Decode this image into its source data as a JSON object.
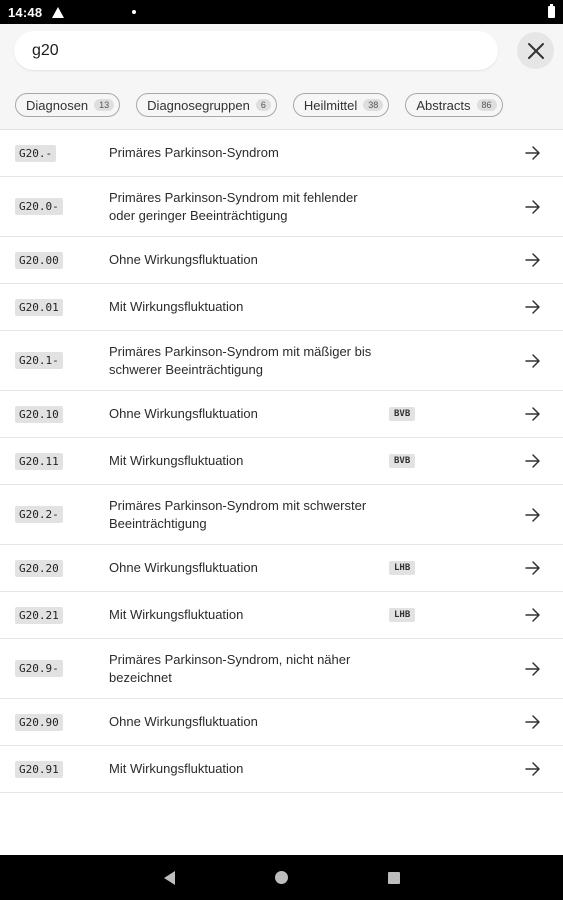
{
  "status_bar": {
    "time": "14:48"
  },
  "search": {
    "value": "g20"
  },
  "filters": [
    {
      "label": "Diagnosen",
      "count": "13"
    },
    {
      "label": "Diagnosegruppen",
      "count": "6"
    },
    {
      "label": "Heilmittel",
      "count": "38"
    },
    {
      "label": "Abstracts",
      "count": "86"
    }
  ],
  "results": [
    {
      "code": "G20.-",
      "description": "Primäres Parkinson-Syndrom",
      "tag": ""
    },
    {
      "code": "G20.0-",
      "description": "Primäres Parkinson-Syndrom mit fehlender oder geringer Beeinträchtigung",
      "tag": ""
    },
    {
      "code": "G20.00",
      "description": "Ohne Wirkungsfluktuation",
      "tag": ""
    },
    {
      "code": "G20.01",
      "description": "Mit Wirkungsfluktuation",
      "tag": ""
    },
    {
      "code": "G20.1-",
      "description": "Primäres Parkinson-Syndrom mit mäßiger bis schwerer Beeinträchtigung",
      "tag": ""
    },
    {
      "code": "G20.10",
      "description": "Ohne Wirkungsfluktuation",
      "tag": "BVB"
    },
    {
      "code": "G20.11",
      "description": "Mit Wirkungsfluktuation",
      "tag": "BVB"
    },
    {
      "code": "G20.2-",
      "description": "Primäres Parkinson-Syndrom mit schwerster Beeinträchtigung",
      "tag": ""
    },
    {
      "code": "G20.20",
      "description": "Ohne Wirkungsfluktuation",
      "tag": "LHB"
    },
    {
      "code": "G20.21",
      "description": "Mit Wirkungsfluktuation",
      "tag": "LHB"
    },
    {
      "code": "G20.9-",
      "description": "Primäres Parkinson-Syndrom, nicht näher bezeichnet",
      "tag": ""
    },
    {
      "code": "G20.90",
      "description": "Ohne Wirkungsfluktuation",
      "tag": ""
    },
    {
      "code": "G20.91",
      "description": "Mit Wirkungsfluktuation",
      "tag": ""
    }
  ],
  "icons": {
    "close": "close-icon",
    "arrow": "arrow-right-icon",
    "back": "nav-back-icon",
    "home": "nav-home-icon",
    "recent": "nav-recent-icon"
  }
}
